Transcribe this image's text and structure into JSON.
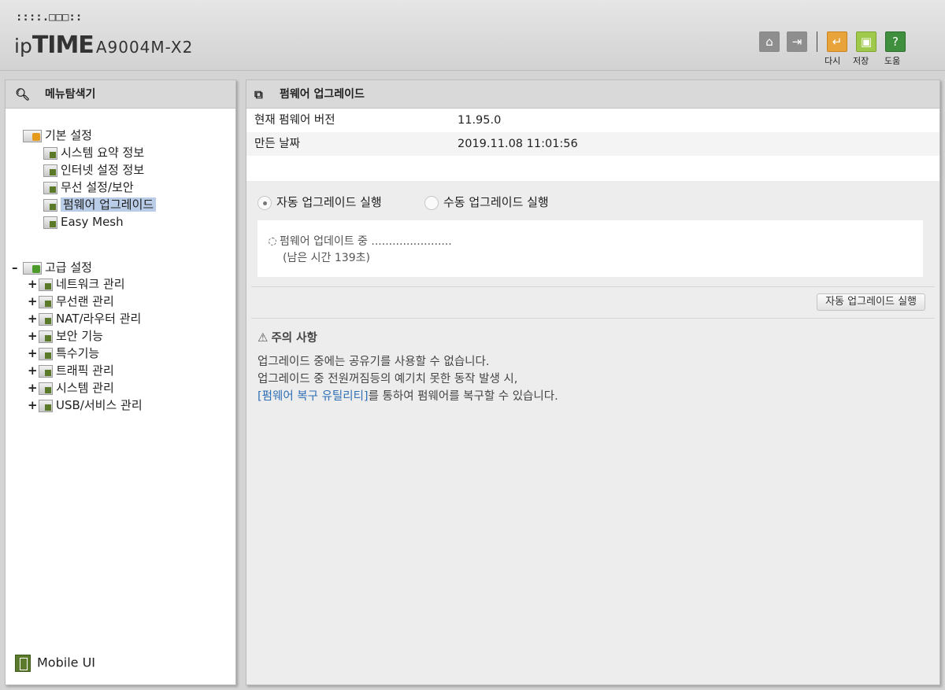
{
  "header": {
    "logo_dots": "::::.□□□::",
    "logo_ip": "ip",
    "logo_time": "TIME",
    "model": "A9004M-X2",
    "buttons": [
      {
        "name": "home",
        "icon": "home-icon"
      },
      {
        "name": "logout",
        "icon": "logout-icon"
      },
      {
        "name": "undo",
        "icon": "undo-icon",
        "label": "다시"
      },
      {
        "name": "save",
        "icon": "save-icon",
        "label": "저장"
      },
      {
        "name": "help",
        "icon": "help-icon",
        "label": "도움"
      }
    ],
    "help_glyph": "?"
  },
  "sidebar": {
    "title": "메뉴탐색기",
    "basic": {
      "label": "기본 설정",
      "items": [
        {
          "label": "시스템 요약 정보"
        },
        {
          "label": "인터넷 설정 정보"
        },
        {
          "label": "무선 설정/보안"
        },
        {
          "label": "펌웨어 업그레이드",
          "selected": true
        },
        {
          "label": "Easy Mesh"
        }
      ]
    },
    "advanced": {
      "label": "고급 설정",
      "collapse_glyph": "–",
      "expand_glyph": "+",
      "items": [
        {
          "label": "네트워크 관리"
        },
        {
          "label": "무선랜 관리"
        },
        {
          "label": "NAT/라우터 관리"
        },
        {
          "label": "보안 기능"
        },
        {
          "label": "특수기능"
        },
        {
          "label": "트래픽 관리"
        },
        {
          "label": "시스템 관리"
        },
        {
          "label": "USB/서비스 관리"
        }
      ]
    },
    "mobile_ui": "Mobile UI"
  },
  "main": {
    "title": "펌웨어 업그레이드",
    "info": [
      {
        "key": "현재 펌웨어 버전",
        "value": "11.95.0"
      },
      {
        "key": "만든 날짜",
        "value": "2019.11.08 11:01:56"
      }
    ],
    "radio_auto": "자동 업그레이드 실행",
    "radio_manual": "수동 업그레이드 실행",
    "selected_mode": "auto",
    "status_line": "펌웨어 업데이트 중 .......................",
    "remaining": "(남은 시간 139초)",
    "run_button": "자동 업그레이드 실행",
    "notice": {
      "title": "주의 사항",
      "warn_glyph": "⚠",
      "line1": "업그레이드 중에는 공유기를 사용할 수 없습니다.",
      "line2": "업그레이드 중 전원꺼짐등의 예기치 못한 동작 발생 시,",
      "link": "[펌웨어 복구 유틸리티]",
      "line3_rest": "를 통하여 펌웨어를 복구할 수 있습니다."
    }
  },
  "colors": {
    "undo": "#e8a33b",
    "save": "#9fc94a",
    "help": "#3f8f3f",
    "link": "#2f6fb5",
    "selected": "#b9cde8"
  }
}
